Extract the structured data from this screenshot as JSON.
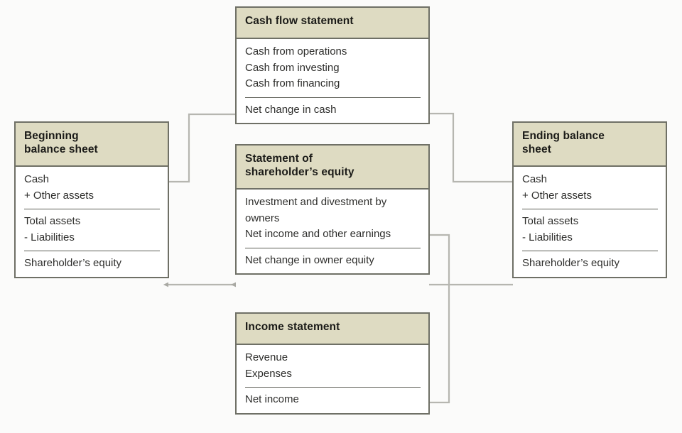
{
  "diagram": {
    "title": "Financial statement articulation flow",
    "background_color": "#fbfbfa",
    "header_fill": "#dedbc2",
    "border_color": "#6f7066",
    "connector_color": "#b2b2ac"
  },
  "boxes": {
    "cash_flow": {
      "title": "Cash flow statement",
      "items": [
        "Cash from operations",
        "Cash from investing",
        "Cash from financing"
      ],
      "total": "Net change in cash"
    },
    "beginning_balance_sheet": {
      "title": "Beginning\nbalance sheet",
      "title_line1": "Beginning",
      "title_line2": "balance sheet",
      "assets": [
        "Cash",
        "+ Other assets"
      ],
      "subtotals": [
        "Total assets",
        "- Liabilities"
      ],
      "total": "Shareholder’s equity"
    },
    "shareholders_equity": {
      "title_line1": "Statement of",
      "title_line2": "shareholder’s equity",
      "items": [
        "Investment and divestment by owners",
        "Net income and other earnings"
      ],
      "total": "Net change in owner equity"
    },
    "ending_balance_sheet": {
      "title_line1": "Ending balance",
      "title_line2": "sheet",
      "assets": [
        "Cash",
        "+ Other assets"
      ],
      "subtotals": [
        "Total assets",
        "- Liabilities"
      ],
      "total": "Shareholder’s equity"
    },
    "income_statement": {
      "title": "Income statement",
      "items": [
        "Revenue",
        "Expenses"
      ],
      "total": "Net income"
    }
  },
  "connectors": [
    {
      "name": "beginning-cash-to-net-change-in-cash",
      "from": "Beginning balance sheet: Cash",
      "to": "Cash flow statement: Net change in cash"
    },
    {
      "name": "net-change-in-cash-to-ending-cash",
      "from": "Cash flow statement: Net change in cash",
      "to": "Ending balance sheet: Cash"
    },
    {
      "name": "beginning-equity-to-net-change-in-owner-equity",
      "from": "Beginning balance sheet: Shareholder’s equity",
      "to": "Statement of shareholder’s equity: Net change in owner equity"
    },
    {
      "name": "net-change-in-owner-equity-to-ending-equity",
      "from": "Statement of shareholder’s equity: Net change in owner equity",
      "to": "Ending balance sheet: Shareholder’s equity"
    },
    {
      "name": "net-income-to-net-income-and-other-earnings",
      "from": "Income statement: Net income",
      "to": "Statement of shareholder’s equity: Net income and other earnings"
    }
  ]
}
